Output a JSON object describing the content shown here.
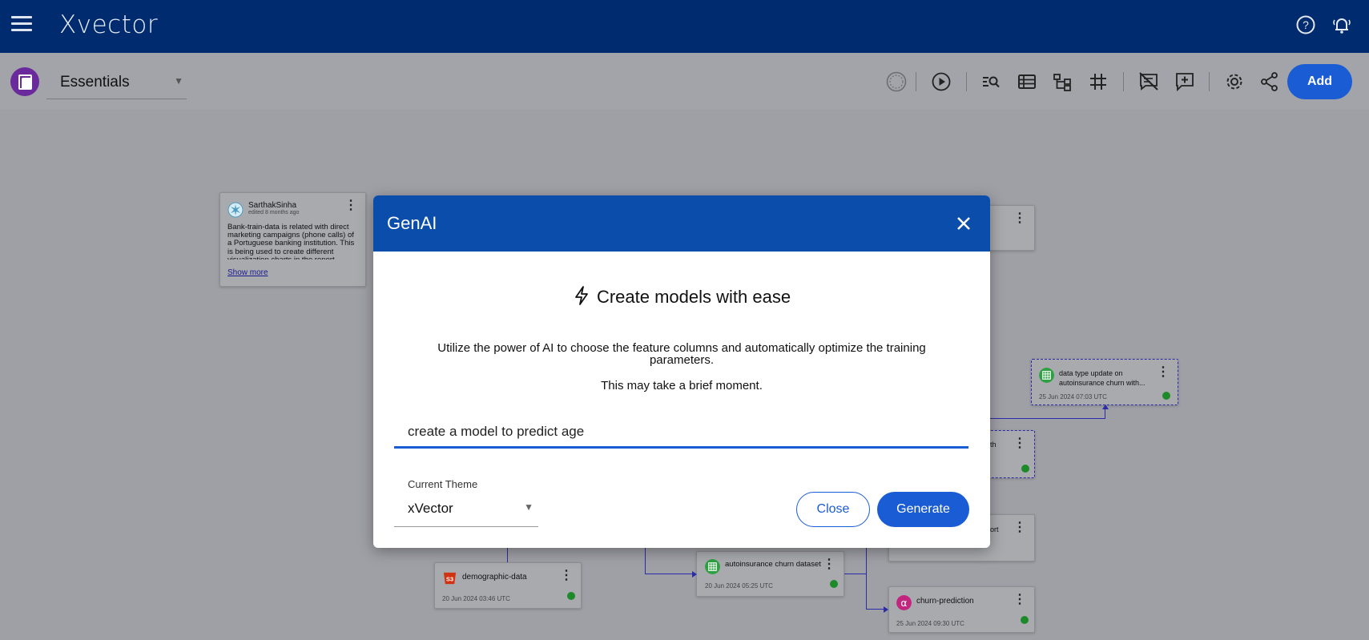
{
  "header": {
    "brand": "Xvector"
  },
  "toolbar": {
    "workspace": "Essentials",
    "add_label": "Add"
  },
  "canvas": {
    "note": {
      "user": "SarthakSinha",
      "edited": "edited 8 months ago",
      "text": "Bank-train-data is related with direct marketing campaigns (phone calls) of a Portuguese banking institution. This is being used to create different visualization charts in the report.",
      "show_more": "Show more"
    },
    "cards": {
      "datatype_title": "data type update on autoinsurance churn with...",
      "datatype_date": "25 Jun 2024 07:03 UTC",
      "partial_a": "th",
      "partial_b": "ort",
      "demographic_title": "demographic-data",
      "demographic_date": "20 Jun 2024 03:46 UTC",
      "dataset_title": "autoinsurance churn dataset",
      "dataset_date": "20 Jun 2024 05:25 UTC",
      "churn_title": "churn-prediction",
      "churn_date": "25 Jun 2024 09:30 UTC",
      "s3_badge": "S3"
    }
  },
  "modal": {
    "title": "GenAI",
    "headline": "Create models with ease",
    "description": "Utilize the power of AI to choose the feature columns and automatically optimize the training parameters.",
    "note": "This may take a brief moment.",
    "prompt_value": "create a model to predict age",
    "theme_label": "Current Theme",
    "theme_value": "xVector",
    "close_label": "Close",
    "generate_label": "Generate"
  },
  "colors": {
    "topbar": "#002b6e",
    "modal_header": "#0b4dab",
    "primary": "#1a5cd3",
    "status_green": "#1d8a2a"
  }
}
